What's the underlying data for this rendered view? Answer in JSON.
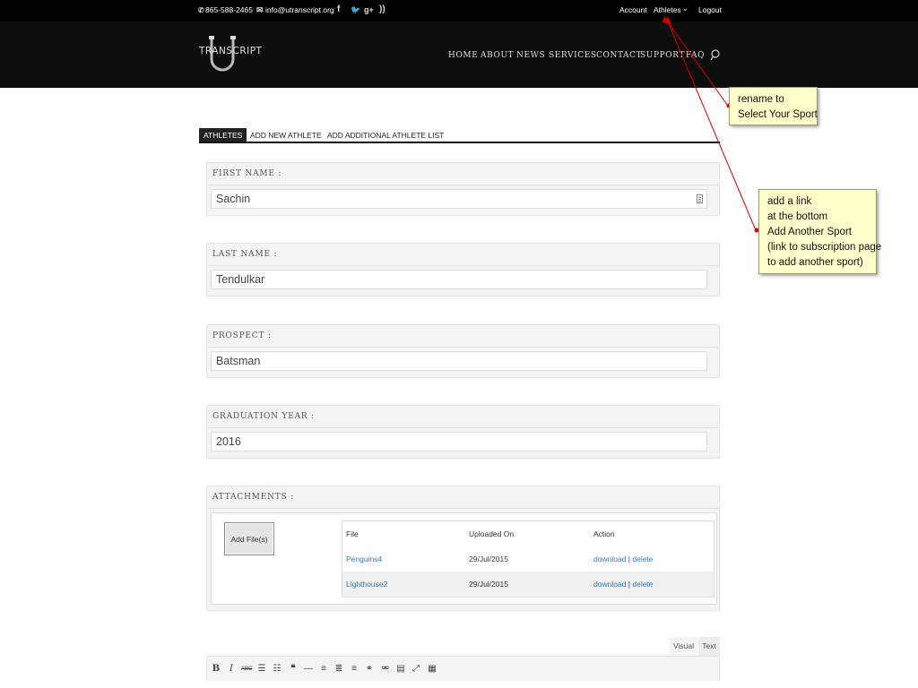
{
  "topbar": {
    "phone": "865-588-2465",
    "email": "info@utranscript.org",
    "account_label": "Account",
    "athletes_label": "Athletes",
    "logout_label": "Logout"
  },
  "header": {
    "logo_text": "TRANSCRIPT",
    "nav": [
      "HOME",
      "ABOUT",
      "NEWS",
      "SERVICES",
      "CONTACT",
      "SUPPORT",
      "FAQ"
    ]
  },
  "tabs": [
    "ATHLETES",
    "ADD NEW ATHLETE",
    "ADD ADDITIONAL ATHLETE LIST"
  ],
  "form": {
    "first_name": {
      "label": "FIRST NAME :",
      "value": "Sachin"
    },
    "last_name": {
      "label": "LAST NAME :",
      "value": "Tendulkar"
    },
    "prospect": {
      "label": "PROSPECT :",
      "value": "Batsman"
    },
    "graduation_year": {
      "label": "GRADUATION YEAR :",
      "value": "2016"
    }
  },
  "attachments": {
    "label": "ATTACHMENTS :",
    "add_button": "Add File(s)",
    "headers": [
      "File",
      "Uploaded On",
      "Action"
    ],
    "rows": [
      {
        "file": "Penguins4",
        "date": "29/Jul/2015",
        "download": "download",
        "sep": "|",
        "delete": "delete"
      },
      {
        "file": "Lighthouse2",
        "date": "29/Jul/2015",
        "download": "download",
        "sep": "|",
        "delete": "delete"
      }
    ]
  },
  "editor": {
    "tab_visual": "Visual",
    "tab_text": "Text",
    "toolbar": [
      "B",
      "I",
      "ABC",
      "☰",
      "☷",
      "❝",
      "—",
      "≡",
      "≣",
      "≡",
      "⚭",
      "⚮",
      "▤",
      "⤢",
      "▦"
    ]
  },
  "annotations": {
    "note1": [
      "rename to",
      "Select Your Sport"
    ],
    "note2": [
      "add a link",
      "at the bottom",
      "Add Another Sport",
      "(link to subscription page",
      "to add another sport)"
    ]
  },
  "colors": {
    "link": "#2e7bbf",
    "annotation_bg": "#ffffcc",
    "arrow": "#cc0000"
  }
}
